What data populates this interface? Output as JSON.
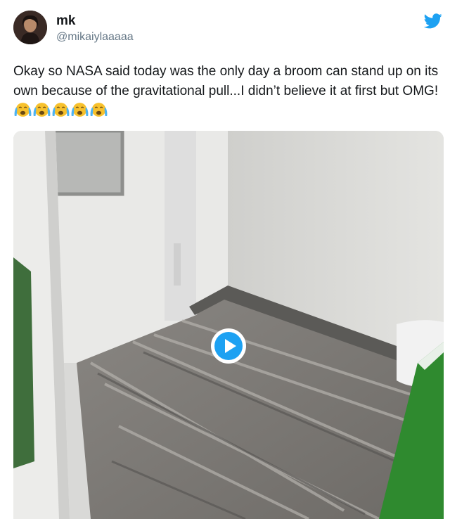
{
  "author": {
    "name": "mk",
    "handle": "@mikaiylaaaaa"
  },
  "tweet": {
    "text": "Okay so NASA said today was the only day a broom can stand up on its own because of the gravitational pull...I didn’t believe it at first but OMG!",
    "emoji": [
      "loudly-crying-face",
      "loudly-crying-face",
      "loudly-crying-face",
      "loudly-crying-face",
      "loudly-crying-face"
    ]
  },
  "icons": {
    "brand": "twitter-bird-icon",
    "play": "play-icon"
  },
  "colors": {
    "twitter_blue": "#1da1f2",
    "text": "#14171a",
    "secondary_text": "#657786",
    "play_button": "#1da1f2"
  }
}
